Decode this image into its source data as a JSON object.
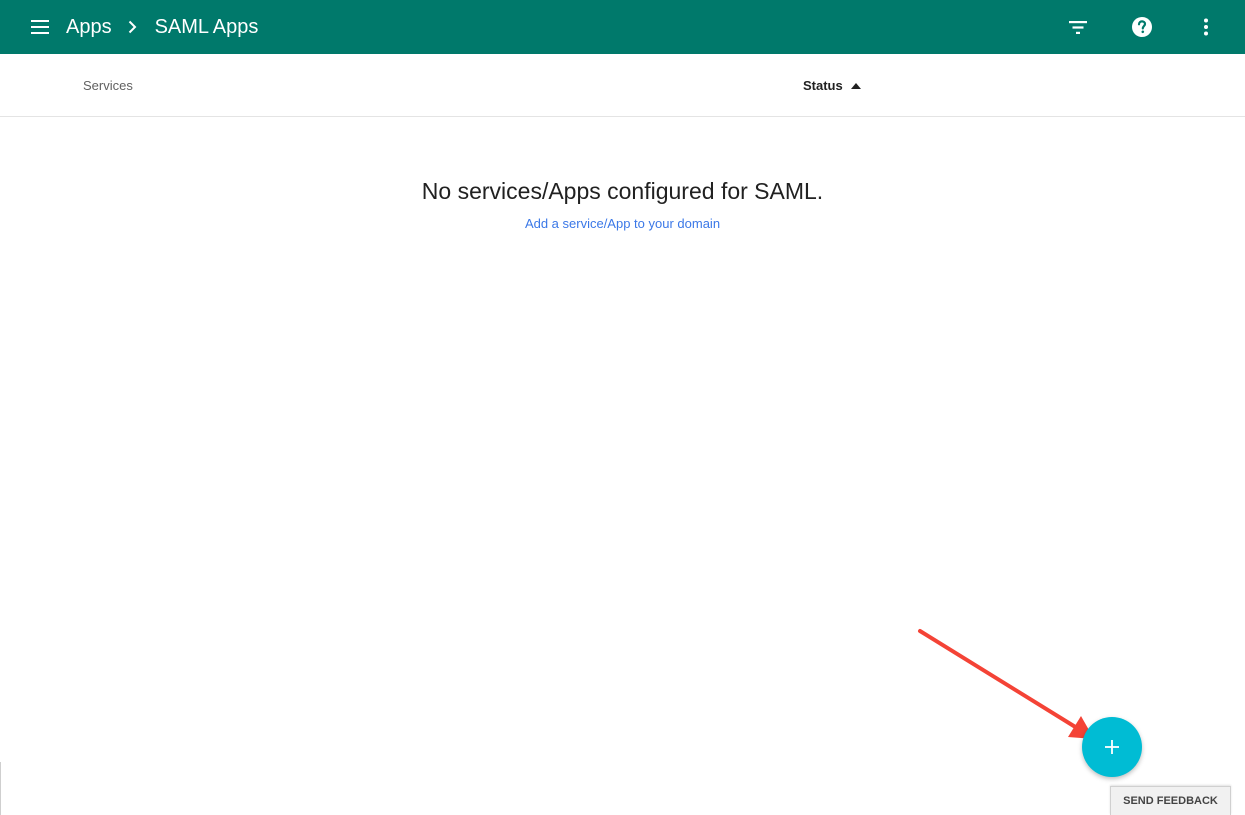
{
  "header": {
    "breadcrumbs": [
      {
        "label": "Apps"
      },
      {
        "label": "SAML Apps"
      }
    ],
    "icons": {
      "menu": "menu-icon",
      "separator": "chevron-right-icon",
      "filter": "filter-icon",
      "help": "help-icon",
      "more": "more-vert-icon"
    }
  },
  "table": {
    "columns": {
      "services": "Services",
      "status": "Status"
    },
    "sort_icon": "sort-ascending-icon"
  },
  "empty_state": {
    "title": "No services/Apps configured for SAML.",
    "link": "Add a service/App to your domain"
  },
  "fab": {
    "icon": "add-icon"
  },
  "feedback": {
    "label": "SEND FEEDBACK"
  },
  "colors": {
    "appbar": "#00796b",
    "fab": "#00bcd4",
    "link": "#3b78e7",
    "annotation": "#f44336"
  }
}
